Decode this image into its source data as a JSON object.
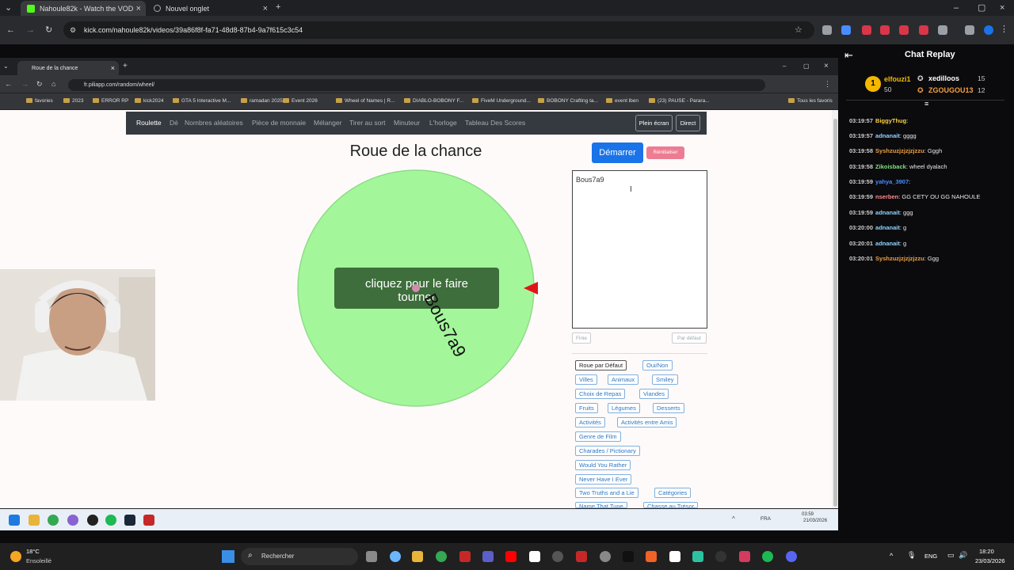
{
  "outer_browser": {
    "tabs": [
      {
        "label": "Nahoule82k - Watch the VOD",
        "active": true
      },
      {
        "label": "Nouvel onglet",
        "active": false
      }
    ],
    "url": "kick.com/nahoule82k/videos/39a86f8f-fa71-48d8-87b4-9a7f615c3c54",
    "new_tab_glyph": "+"
  },
  "inner_browser": {
    "tab_label": "Roue de la chance",
    "url": "fr.piliapp.com/random/wheel/",
    "bookmarks": [
      "favories",
      "2023",
      "ERROR RP",
      "kick2024",
      "GTA 5 Interactive M...",
      "ramadan 2025",
      "Event 2026",
      "Wheel of Names | R...",
      "DIABLO-BOBONY F...",
      "FiveM Underground...",
      "BOBONY Crafting ta...",
      "event lben",
      "(23) PAUSE - Parara...",
      "Tous les favoris"
    ]
  },
  "nav": {
    "links": [
      "Roulette",
      "Dé",
      "Nombres aléatoires",
      "Pièce de monnaie",
      "Mélanger",
      "Tirer au sort",
      "Minuteur",
      "L'horloge",
      "Tableau Des Scores"
    ],
    "fullscreen": "Plein écran",
    "live": "Direct"
  },
  "wheel": {
    "title": "Roue de la chance",
    "click_label": "cliquez pour le faire tourner",
    "segment_label": "Bous7a9",
    "color": "#a3f79a",
    "pointer_color": "#e0141c"
  },
  "controls": {
    "start": "Démarrer",
    "reset": "Réinitialiser",
    "names_value": "Bous7a9",
    "finish": "Finie",
    "default": "Par défaut"
  },
  "presets": [
    "Roue par Défaut",
    "Oui/Non",
    "Villes",
    "Animaux",
    "Smiley",
    "Choix de Repas",
    "Viandes",
    "Fruits",
    "Légumes",
    "Desserts",
    "Activités",
    "Activités entre Amis",
    "Genre de Film",
    "Charades / Pictionary",
    "Would You Rather",
    "Never Have I Ever",
    "Two Truths and a Lie",
    "Catégories",
    "Name That Tune",
    "Chasse au Trésor"
  ],
  "inner_taskbar": {
    "time": "03:59",
    "date": "21/03/2026",
    "lang": "FRA"
  },
  "chat": {
    "title": "Chat Replay",
    "leaderboard": {
      "first": {
        "rank": "1",
        "name": "elfouzi1",
        "points": "50"
      },
      "second": {
        "name": "xedilloos",
        "points": "15"
      },
      "third": {
        "name": "ZGOUGOU13",
        "points": "12"
      }
    },
    "messages": [
      {
        "time": "03:19:57",
        "user": "BiggyThug",
        "text": "",
        "color": "#f5d142"
      },
      {
        "time": "03:19:57",
        "user": "adnanait",
        "text": "gggg",
        "color": "#8fd3ff"
      },
      {
        "time": "03:19:58",
        "user": "Syshzuzjzjzjzjzzu",
        "text": "Gggh",
        "color": "#f0a040"
      },
      {
        "time": "03:19:58",
        "user": "Zikoisback",
        "text": "wheel dyalach",
        "color": "#7ee37e"
      },
      {
        "time": "03:19:59",
        "user": "yahya_3907",
        "text": "",
        "color": "#4a8cff"
      },
      {
        "time": "03:19:59",
        "user": "nserben",
        "text": "GG CETY OU GG NAHOULE",
        "color": "#ff8c8c"
      },
      {
        "time": "03:19:59",
        "user": "adnanait",
        "text": "ggg",
        "color": "#8fd3ff"
      },
      {
        "time": "03:20:00",
        "user": "adnanait",
        "text": "g",
        "color": "#8fd3ff"
      },
      {
        "time": "03:20:01",
        "user": "adnanait",
        "text": "g",
        "color": "#8fd3ff"
      },
      {
        "time": "03:20:01",
        "user": "Syshzuzjzjzjzjzzu",
        "text": "Ggg",
        "color": "#f0a040"
      }
    ]
  },
  "taskbar": {
    "weather_temp": "18°C",
    "weather_desc": "Ensoleillé",
    "search": "Rechercher",
    "lang": "ENG",
    "time": "18:20",
    "date": "23/03/2026"
  }
}
